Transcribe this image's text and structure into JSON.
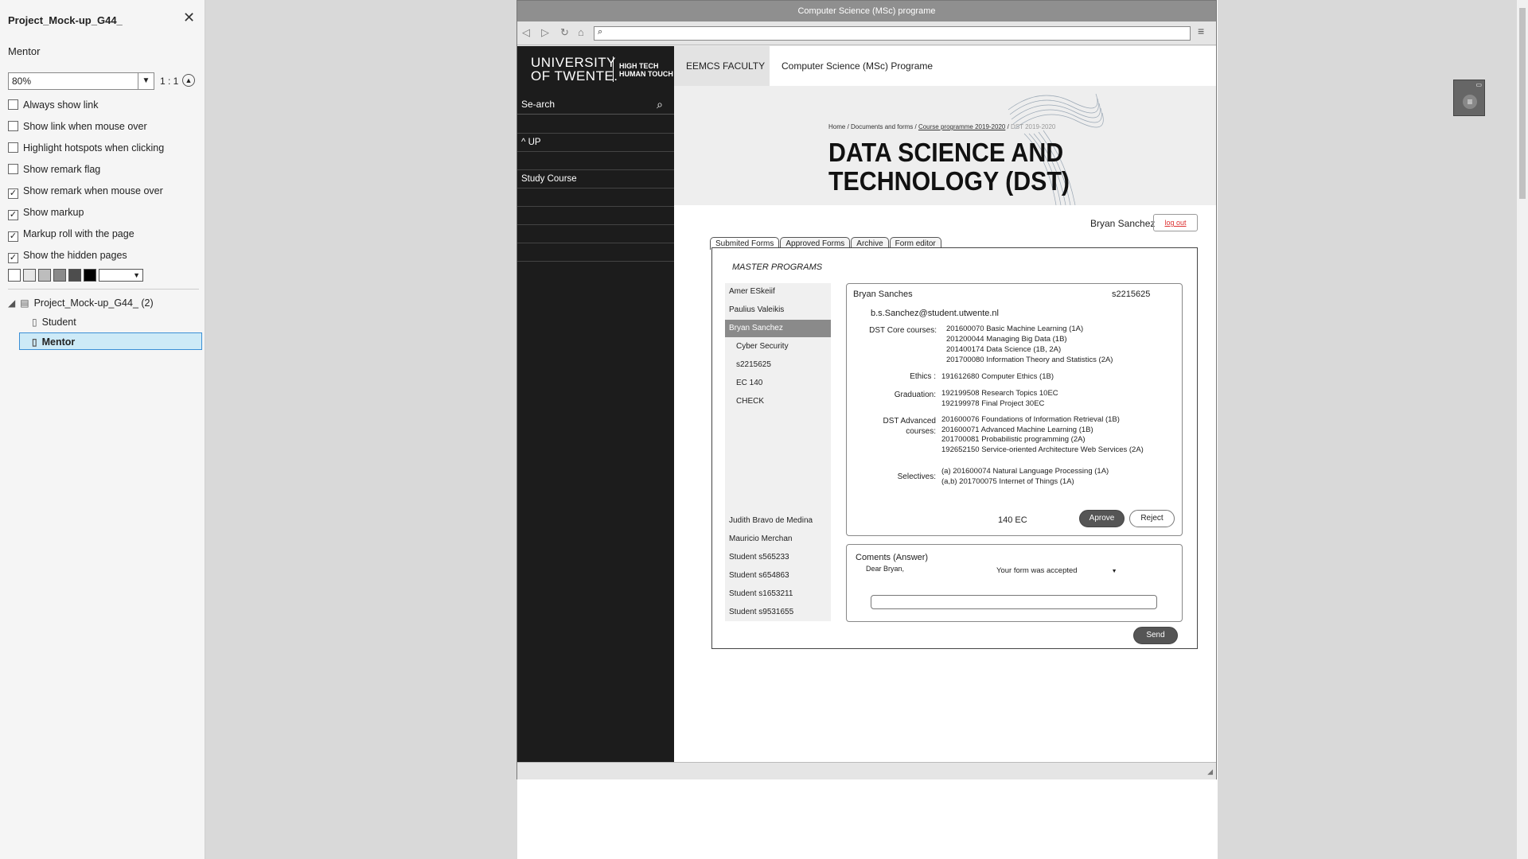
{
  "panel": {
    "title": "Project_Mock-up_G44_",
    "page_name": "Mentor",
    "zoom": "80%",
    "ratio": "1 : 1",
    "options": [
      {
        "label": "Always show link",
        "checked": false
      },
      {
        "label": "Show link when mouse over",
        "checked": false
      },
      {
        "label": "Highlight hotspots when clicking",
        "checked": false
      },
      {
        "label": "Show remark flag",
        "checked": false
      },
      {
        "label": "Show remark when mouse over",
        "checked": true
      },
      {
        "label": "Show markup",
        "checked": true
      },
      {
        "label": "Markup roll with the page",
        "checked": true
      },
      {
        "label": "Show the hidden pages",
        "checked": true
      }
    ],
    "swatches": [
      "#ffffff",
      "#e6e6e6",
      "#bdbdbd",
      "#8a8a8a",
      "#4d4d4d",
      "#000000"
    ],
    "tree": {
      "root": "Project_Mock-up_G44_ (2)",
      "pages": [
        "Student",
        "Mentor"
      ],
      "selected": "Mentor"
    }
  },
  "browser": {
    "title": "Computer Science (MSc) programe"
  },
  "site": {
    "logo_line1": "UNIVERSITY",
    "logo_line2": "OF TWENTE.",
    "logo_tag1": "HIGH TECH",
    "logo_tag2": "HUMAN TOUCH",
    "search_label": "Se-arch",
    "sidebar_up": "^ UP",
    "sidebar_study": "Study Course",
    "faculty": "EEMCS FACULTY  |",
    "program": "Computer Science (MSc) Programe",
    "breadcrumb": {
      "home": "Home",
      "docs": "Documents and forms",
      "course": "Course programme 2019-2020",
      "current": "DST 2019-2020"
    },
    "banner_line1": "DATA SCIENCE AND",
    "banner_line2": "TECHNOLOGY (DST)"
  },
  "user": {
    "name": "Bryan Sanchez",
    "logout": "log out"
  },
  "tabs": [
    "Submited Forms",
    "Approved Forms",
    "Archive",
    "Form editor"
  ],
  "form": {
    "heading": "MASTER PROGRAMS",
    "students": [
      {
        "label": "Amer ESkeiif"
      },
      {
        "label": "Paulius Valeikis"
      },
      {
        "label": "Bryan Sanchez"
      },
      {
        "label": "Cyber  Security"
      },
      {
        "label": "s2215625"
      },
      {
        "label": "EC 140"
      },
      {
        "label": "CHECK"
      },
      {
        "label": "Judith Bravo de Medina"
      },
      {
        "label": "Mauricio Merchan"
      },
      {
        "label": "Student  s565233"
      },
      {
        "label": "Student  s654863"
      },
      {
        "label": "Student s1653211"
      },
      {
        "label": "Student s9531655"
      }
    ],
    "card": {
      "name": "Bryan Sanches",
      "id": "s2215625",
      "email": "b.s.Sanchez@student.utwente.nl",
      "core_label": "DST Core courses:",
      "core": [
        "201600070 Basic Machine Learning (1A)",
        "201200044 Managing Big Data (1B)",
        "201400174 Data Science (1B, 2A)",
        "201700080 Information Theory and Statistics (2A)"
      ],
      "ethics_label": "Ethics :",
      "ethics": "191612680 Computer Ethics (1B)",
      "grad_label": "Graduation:",
      "graduation": [
        "192199508 Research Topics 10EC",
        "192199978 Final Project 30EC"
      ],
      "adv_label1": "DST Advanced",
      "adv_label2": "courses:",
      "advanced": [
        "201600076 Foundations of Information Retrieval (1B)",
        "201600071 Advanced Machine Learning (1B)",
        "201700081 Probabilistic programming (2A)",
        "192652150 Service-oriented Architecture Web Services (2A)"
      ],
      "sel_label": "Selectives:",
      "selectives": [
        "(a) 201600074 Natural Language Processing (1A)",
        "(a,b) 201700075 Internet of Things (1A)"
      ],
      "ec": "140 EC",
      "approve": "Aprove",
      "reject": "Reject"
    },
    "comments": {
      "title": "Coments (Answer)",
      "salutation": "Dear Bryan,",
      "status": "Your form was accepted"
    },
    "send": "Send"
  }
}
